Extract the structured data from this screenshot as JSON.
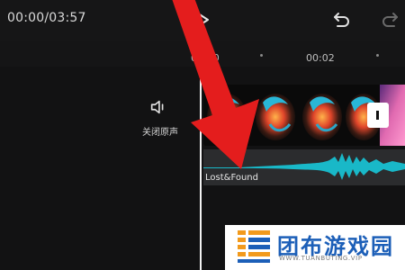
{
  "header": {
    "timecode": "00:00/03:57",
    "icons": [
      "play-icon",
      "undo-icon",
      "redo-icon"
    ]
  },
  "ruler": {
    "ticks": [
      "00:00",
      "00:02"
    ]
  },
  "track_controls": {
    "mute_icon": "speaker-icon",
    "mute_label": "关闭原声"
  },
  "audio": {
    "track_name": "Lost&Found",
    "waveform_color": "#19b8c8"
  },
  "colors": {
    "annotation_arrow": "#e41d1d",
    "brand": "#1c5fb8",
    "accent_orange": "#f29a1c"
  },
  "watermark": {
    "title": "团布游戏园",
    "url": "WWW.TUANBUTING.VIP"
  }
}
